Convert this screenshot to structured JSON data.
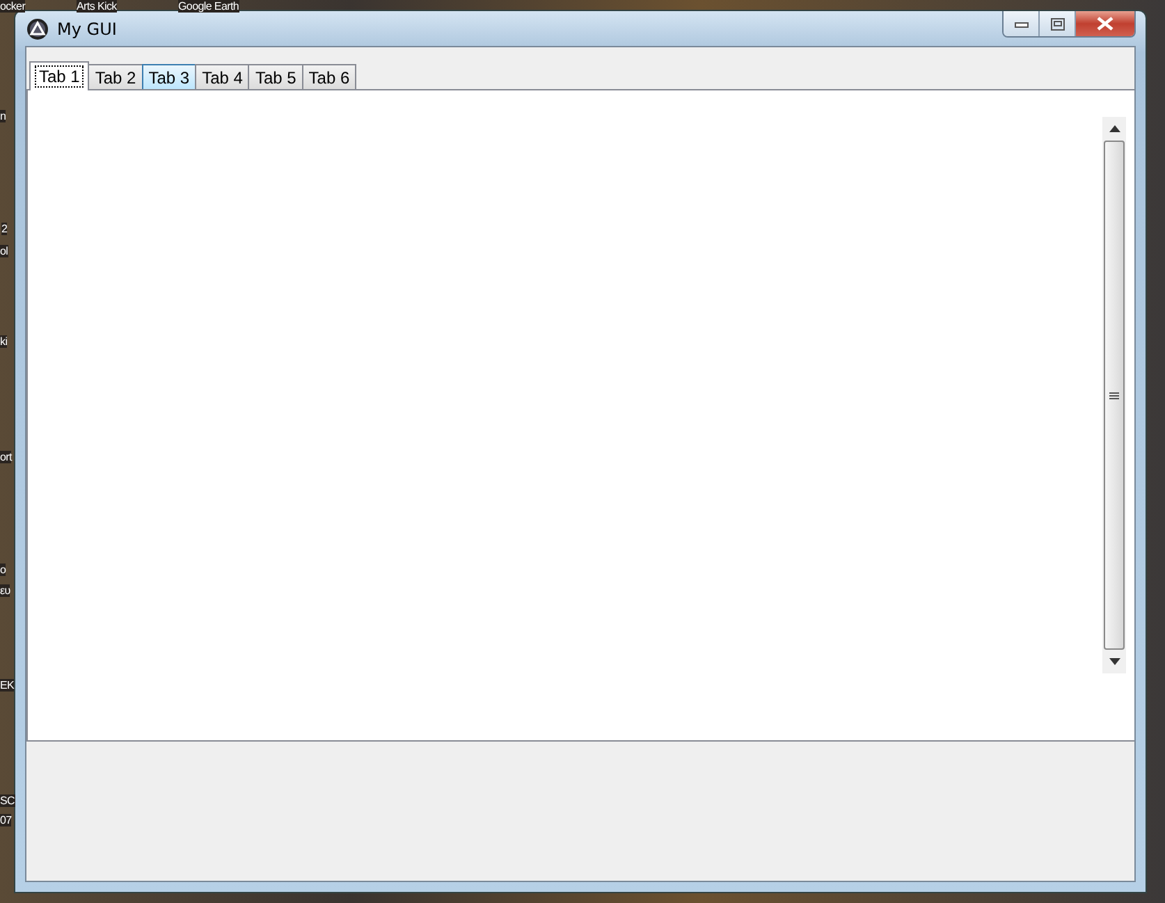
{
  "desktop": {
    "icon_labels": [
      {
        "text": "ocker"
      },
      {
        "text": "Arts Kick"
      },
      {
        "text": "Google Earth"
      },
      {
        "text": "n"
      },
      {
        "text": "2"
      },
      {
        "text": "ol"
      },
      {
        "text": "ki"
      },
      {
        "text": "ort"
      },
      {
        "text": "o"
      },
      {
        "text": "ευ"
      },
      {
        "text": "EK"
      },
      {
        "text": "SC"
      },
      {
        "text": "07"
      }
    ]
  },
  "window": {
    "title": "My GUI"
  },
  "tabs": [
    {
      "label": "Tab 1",
      "selected": true,
      "hovered": false
    },
    {
      "label": "Tab 2",
      "selected": false,
      "hovered": false
    },
    {
      "label": "Tab 3",
      "selected": false,
      "hovered": true
    },
    {
      "label": "Tab 4",
      "selected": false,
      "hovered": false
    },
    {
      "label": "Tab 5",
      "selected": false,
      "hovered": false
    },
    {
      "label": "Tab 6",
      "selected": false,
      "hovered": false
    }
  ]
}
